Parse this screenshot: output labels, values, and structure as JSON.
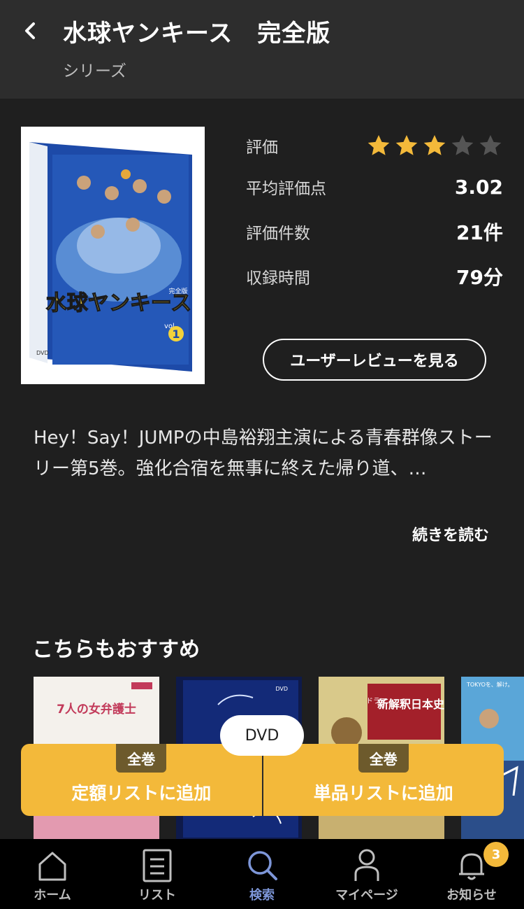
{
  "header": {
    "title": "水球ヤンキース　完全版",
    "subtitle": "シリーズ"
  },
  "poster": {
    "title_text": "水球ヤンキース",
    "edition": "完全版",
    "vol": "vol.",
    "vol_num": "1",
    "dvd": "DVD"
  },
  "rating": {
    "label": "評価",
    "stars_filled": 3,
    "stars_total": 5,
    "avg_label": "平均評価点",
    "avg_value": "3.02",
    "count_label": "評価件数",
    "count_value": "21件",
    "duration_label": "収録時間",
    "duration_value": "79分"
  },
  "review_button": "ユーザーレビューを見る",
  "description": {
    "text": "Hey！Say！JUMPの中島裕翔主演による青春群像ストーリー第5巻。強化合宿を無事に終えた帰り道、…",
    "read_more": "続きを読む"
  },
  "recommend": {
    "title": "こちらもおすすめ",
    "items": [
      {
        "caption": "7人の女弁護士"
      },
      {
        "caption": "DVD"
      },
      {
        "caption": "新解釈日本史",
        "tag": "ドラマ"
      },
      {
        "caption": "TOKYOを、解け。"
      }
    ]
  },
  "actions": {
    "format_chip": "DVD",
    "left": {
      "tag": "全巻",
      "label": "定額リストに追加"
    },
    "right": {
      "tag": "全巻",
      "label": "単品リストに追加"
    }
  },
  "tabbar": {
    "items": [
      {
        "label": "ホーム",
        "icon": "home-icon"
      },
      {
        "label": "リスト",
        "icon": "list-icon"
      },
      {
        "label": "検索",
        "icon": "search-icon",
        "active": true
      },
      {
        "label": "マイページ",
        "icon": "person-icon"
      },
      {
        "label": "お知らせ",
        "icon": "bell-icon",
        "badge": "3"
      }
    ]
  },
  "colors": {
    "accent": "#f3b93a",
    "active_tab": "#7d96d8",
    "background": "#1f1f1f",
    "header": "#2d2d2d"
  }
}
